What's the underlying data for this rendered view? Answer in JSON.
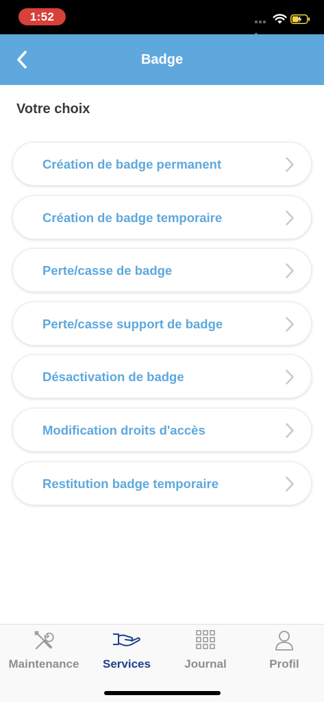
{
  "status_bar": {
    "time": "1:52"
  },
  "header": {
    "title": "Badge",
    "back_icon": "chevron-left-icon"
  },
  "section_title": "Votre choix",
  "menu": {
    "items": [
      {
        "label": "Création de badge permanent"
      },
      {
        "label": "Création de badge temporaire"
      },
      {
        "label": "Perte/casse de badge"
      },
      {
        "label": "Perte/casse support de badge"
      },
      {
        "label": "Désactivation de badge"
      },
      {
        "label": "Modification droits d'accès"
      },
      {
        "label": "Restitution badge temporaire"
      }
    ]
  },
  "tab_bar": {
    "active": "Services",
    "tabs": [
      {
        "label": "Maintenance",
        "icon": "tools-icon"
      },
      {
        "label": "Services",
        "icon": "hand-icon"
      },
      {
        "label": "Journal",
        "icon": "grid-icon"
      },
      {
        "label": "Profil",
        "icon": "user-icon"
      }
    ]
  },
  "colors": {
    "accent": "#5ea8dd",
    "active_tab": "#1e3f8a",
    "inactive_tab": "#8e8e8e",
    "time_pill": "#d8403a"
  }
}
